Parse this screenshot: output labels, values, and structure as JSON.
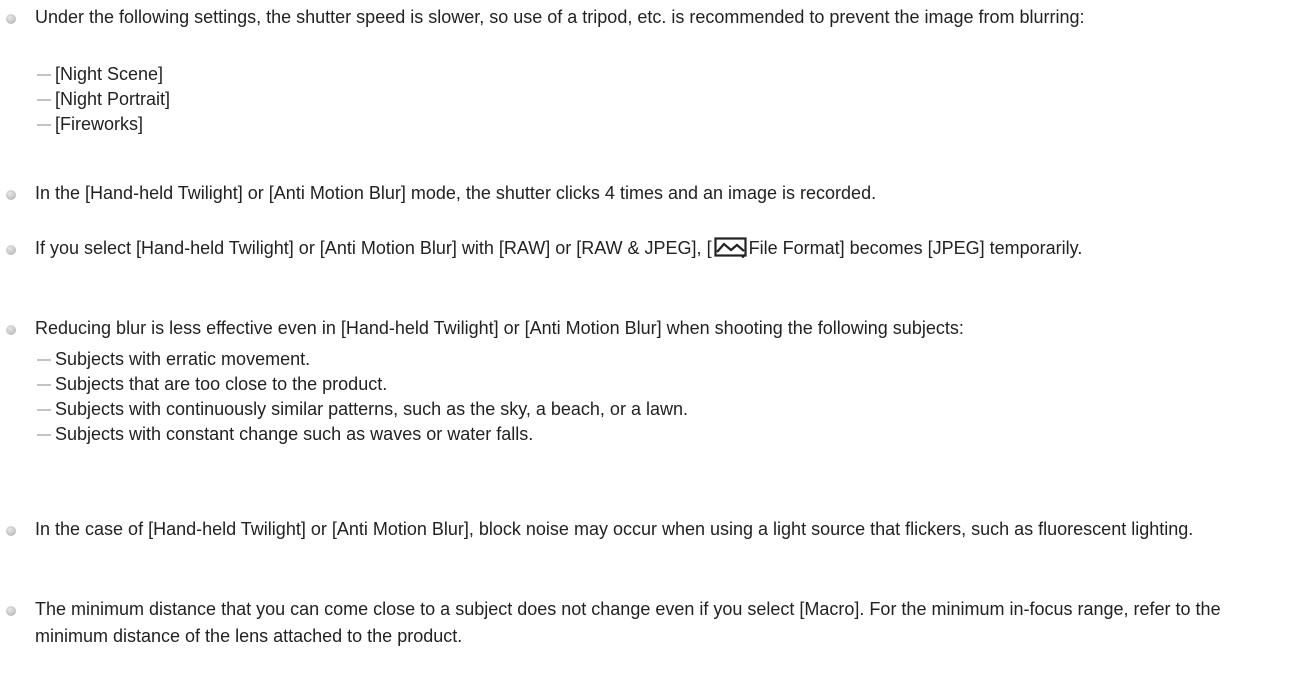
{
  "notes": [
    {
      "text": "Under the following settings, the shutter speed is slower, so use of a tripod, etc. is recommended to prevent the image from blurring:",
      "subitems": [
        "[Night Scene]",
        "[Night Portrait]",
        "[Fireworks]"
      ]
    },
    {
      "text": "In the [Hand-held Twilight] or [Anti Motion Blur] mode, the shutter clicks 4 times and an image is recorded."
    },
    {
      "text_before_icon": "If you select [Hand-held Twilight] or [Anti Motion Blur] with [RAW] or [RAW & JPEG], [",
      "icon": "still-image-file-format-icon",
      "text_after_icon": "File Format] becomes [JPEG] temporarily."
    },
    {
      "text": "Reducing blur is less effective even in [Hand-held Twilight] or [Anti Motion Blur] when shooting the following subjects:",
      "subitems": [
        "Subjects with erratic movement.",
        "Subjects that are too close to the product.",
        "Subjects with continuously similar patterns, such as the sky, a beach, or a lawn.",
        "Subjects with constant change such as waves or water falls."
      ]
    },
    {
      "text": "In the case of [Hand-held Twilight] or [Anti Motion Blur], block noise may occur when using a light source that flickers, such as fluorescent lighting."
    },
    {
      "text": "The minimum distance that you can come close to a subject does not change even if you select [Macro]. For the minimum in-focus range, refer to the minimum distance of the lens attached to the product."
    }
  ],
  "colors": {
    "text": "#222222",
    "bullet": "#c4c4c4",
    "background": "#ffffff"
  }
}
